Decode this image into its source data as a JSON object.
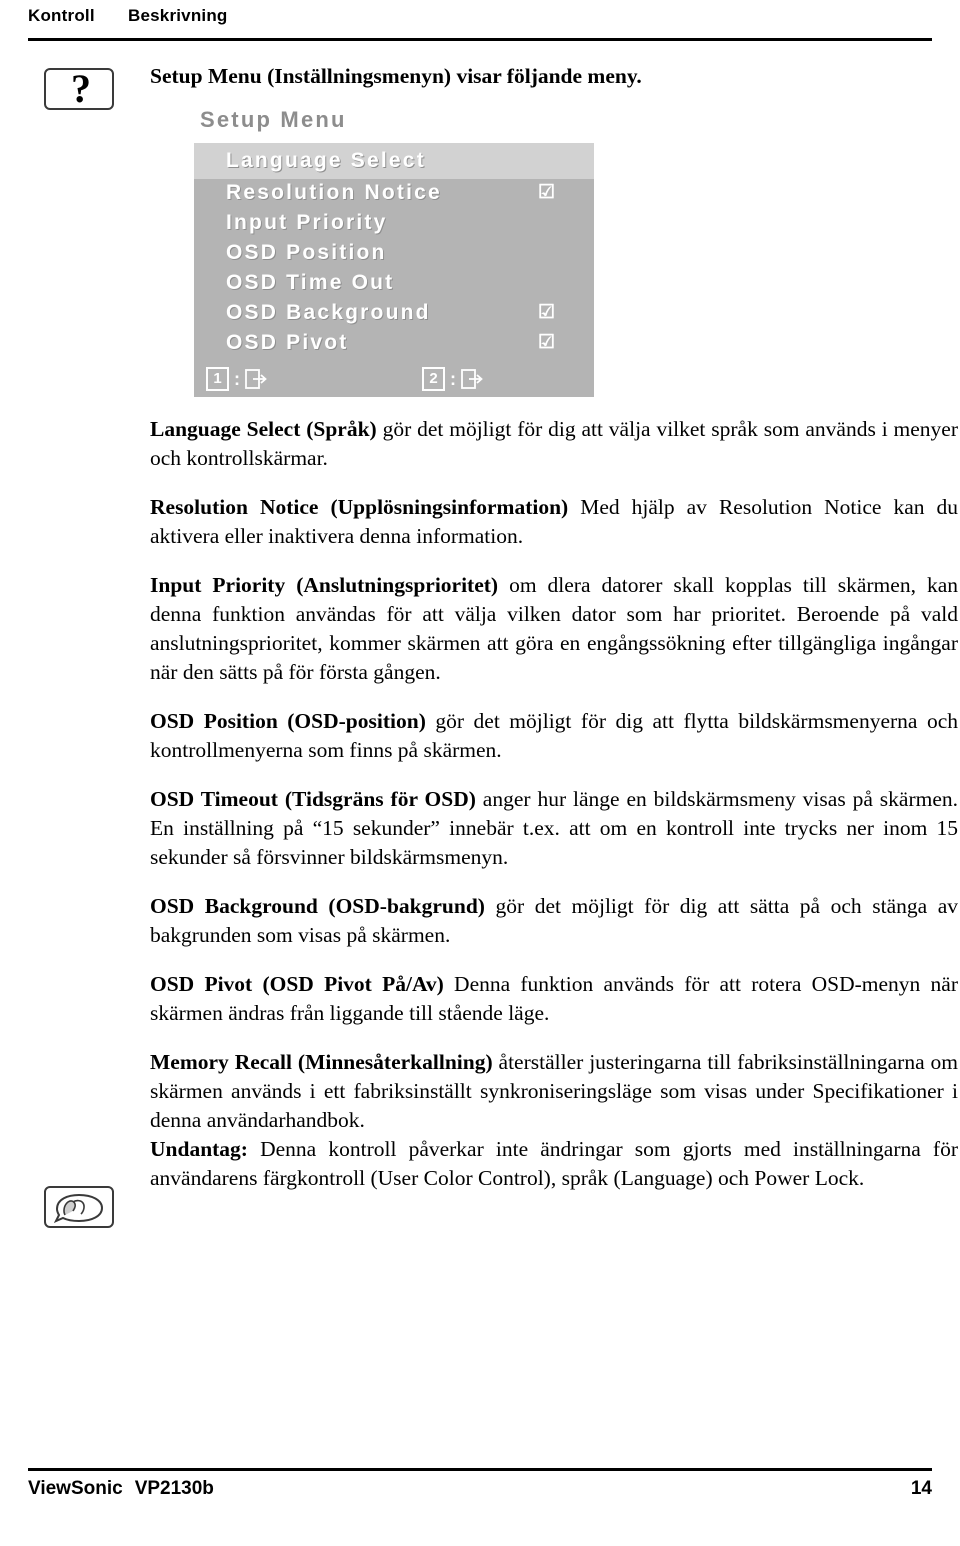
{
  "header": {
    "col1": "Kontroll",
    "col2": "Beskrivning"
  },
  "icons": {
    "question": "?",
    "note_name": "note-hand-icon"
  },
  "intro": "Setup Menu (Inställningsmenyn) visar följande meny.",
  "osd": {
    "title": "Setup Menu",
    "rows": [
      {
        "label": "Language Select",
        "check": "",
        "highlight": true
      },
      {
        "label": "Resolution Notice",
        "check": "☑",
        "highlight": false
      },
      {
        "label": "Input Priority",
        "check": "",
        "highlight": false
      },
      {
        "label": "OSD Position",
        "check": "",
        "highlight": false
      },
      {
        "label": "OSD Time Out",
        "check": "",
        "highlight": false
      },
      {
        "label": "OSD Background",
        "check": "☑",
        "highlight": false
      },
      {
        "label": "OSD Pivot",
        "check": "☑",
        "highlight": false
      }
    ],
    "footer": {
      "key1": "1",
      "sep1": ":",
      "icon1": "exit-icon",
      "key2": "2",
      "sep2": ":",
      "icon2": "enter-icon"
    }
  },
  "paragraphs": [
    {
      "id": "language-select",
      "bold": "Language Select (Språk)",
      "text": " gör det möjligt för dig att välja vilket språk som används i menyer och kontrollskärmar."
    },
    {
      "id": "resolution-notice",
      "bold": "Resolution Notice (Upplösningsinformation)",
      "text": " Med hjälp av Resolution Notice kan du aktivera eller inaktivera denna information."
    },
    {
      "id": "input-priority",
      "bold": "Input Priority (Anslutningsprioritet)",
      "text": " om dlera datorer skall kopplas till skärmen, kan denna funktion användas för att välja vilken dator som har prioritet. Beroende på vald anslutningsprioritet, kommer skärmen att göra en engångssökning efter tillgängliga ingångar när den sätts på för första gången."
    },
    {
      "id": "osd-position",
      "bold": "OSD Position (OSD-position)",
      "text": " gör det möjligt för dig att flytta bildskärmsmenyerna och kontrollmenyerna som finns på skärmen."
    },
    {
      "id": "osd-timeout",
      "bold": "OSD Timeout (Tidsgräns för OSD)",
      "text": " anger hur länge en bildskärmsmeny visas på skärmen. En inställning på “15 sekunder” innebär t.ex. att om en kontroll inte trycks ner inom 15 sekunder så försvinner bildskärmsmenyn."
    },
    {
      "id": "osd-background",
      "bold": "OSD Background (OSD-bakgrund)",
      "text": " gör det möjligt för dig att sätta på och stänga av bakgrunden som visas på skärmen."
    },
    {
      "id": "osd-pivot",
      "bold": "OSD Pivot (OSD Pivot På/Av)",
      "text": " Denna funktion används för att rotera OSD-menyn när skärmen ändras från liggande till stående läge."
    },
    {
      "id": "memory-recall",
      "bold": "Memory Recall (Minnesåterkallning)",
      "text": " återställer justeringarna till fabriksinställningarna om skärmen används i ett fabriksinställt synkroniseringsläge som visas under Specifikationer i denna användarhandbok."
    },
    {
      "id": "undantag",
      "bold": "Undantag:",
      "text": " Denna kontroll påverkar inte ändringar som gjorts med inställningarna för användarens färgkontroll (User Color Control), språk (Language) och Power Lock."
    }
  ],
  "footer": {
    "brand": "ViewSonic",
    "model": "VP2130b",
    "page": "14"
  }
}
